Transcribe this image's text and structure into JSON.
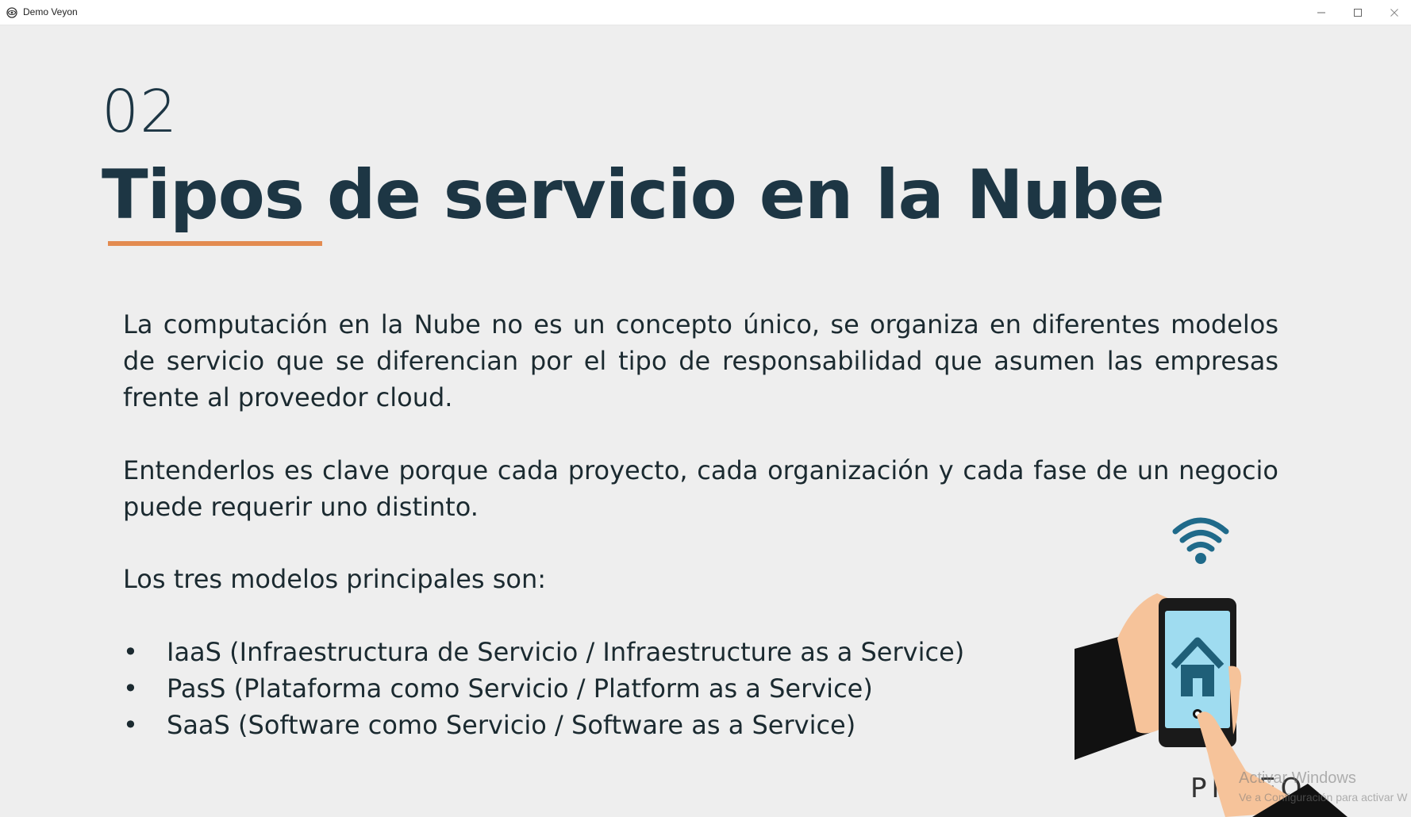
{
  "window": {
    "title": "Demo Veyon"
  },
  "slide": {
    "section_number": "02",
    "title": "Tipos de servicio en la Nube",
    "accent_color": "#e38b50",
    "title_color": "#1d3644",
    "paragraphs": [
      "La computación en la Nube no es un concepto único, se organiza en diferentes modelos de servicio que se diferencian por el tipo de responsabilidad que asumen las empresas frente al proveedor cloud.",
      "Entenderlos es clave porque cada proyecto, cada organización y cada fase de un negocio puede requerir uno distinto.",
      "Los tres modelos principales son:"
    ],
    "bullets": [
      "IaaS (Infraestructura de Servicio / Infraestructure as a Service)",
      "PasS (Plataforma como Servicio / Platform as a Service)",
      "SaaS (Software como Servicio / Software as a Service)"
    ],
    "bullet_symbol": "•",
    "brand_partial": "PI TEO",
    "illustration": "hand-holding-smartphone-home-wifi-icon"
  },
  "watermark": {
    "title": "Activar Windows",
    "subtitle": "Ve a Configuración para activar W"
  }
}
